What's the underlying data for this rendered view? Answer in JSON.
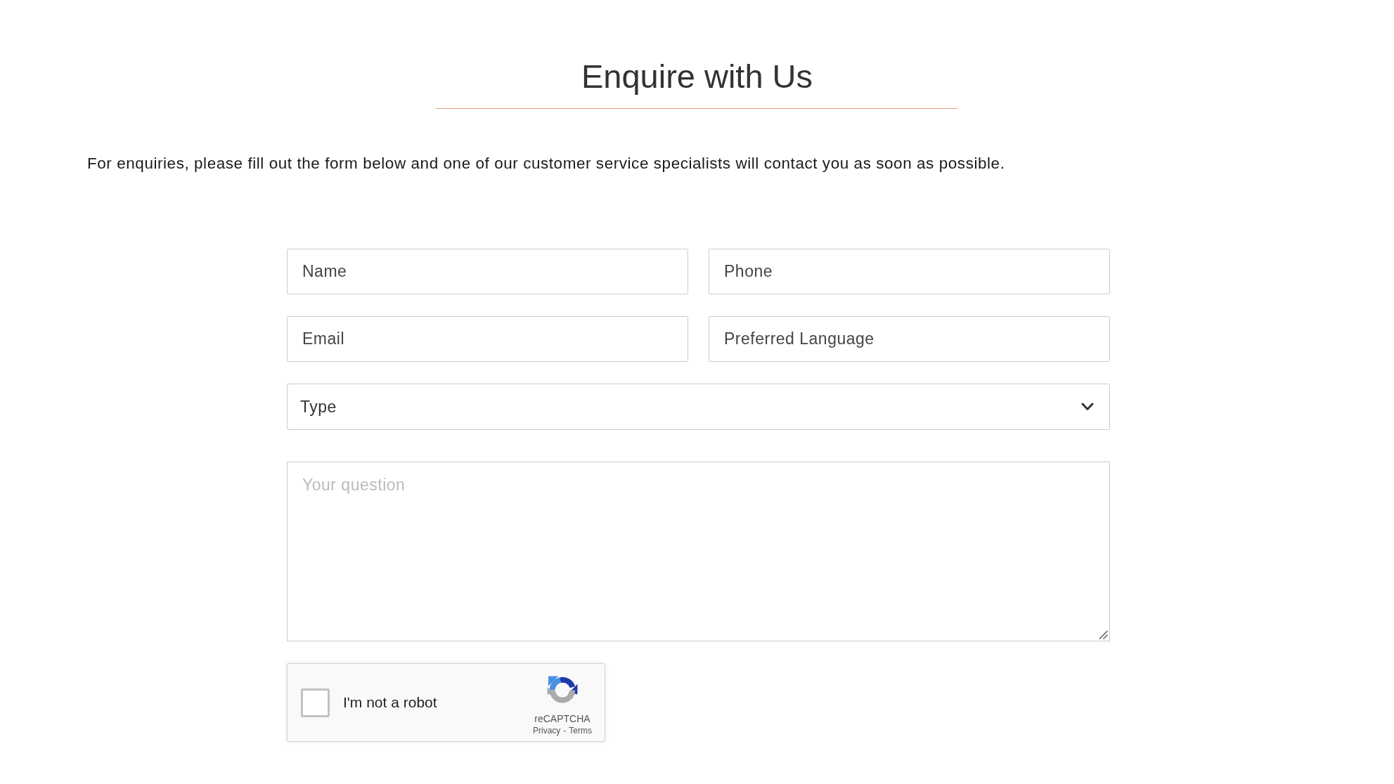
{
  "header": {
    "title": "Enquire with Us"
  },
  "intro": "For enquiries, please fill out the form below and one of our customer service specialists will contact you as soon as possible.",
  "form": {
    "fields": [
      {
        "kind": "input",
        "placeholder": "Name"
      },
      {
        "kind": "input",
        "placeholder": "Phone"
      },
      {
        "kind": "input",
        "placeholder": "Email"
      },
      {
        "kind": "input",
        "placeholder": "Preferred Language"
      },
      {
        "kind": "select",
        "value": "Type"
      },
      {
        "kind": "textarea",
        "placeholder": "Your question"
      }
    ],
    "captcha": {
      "label": "I'm not a robot",
      "checked": false,
      "brand": "reCAPTCHA",
      "links": [
        "Privacy",
        "Terms"
      ],
      "separator": "-"
    }
  }
}
